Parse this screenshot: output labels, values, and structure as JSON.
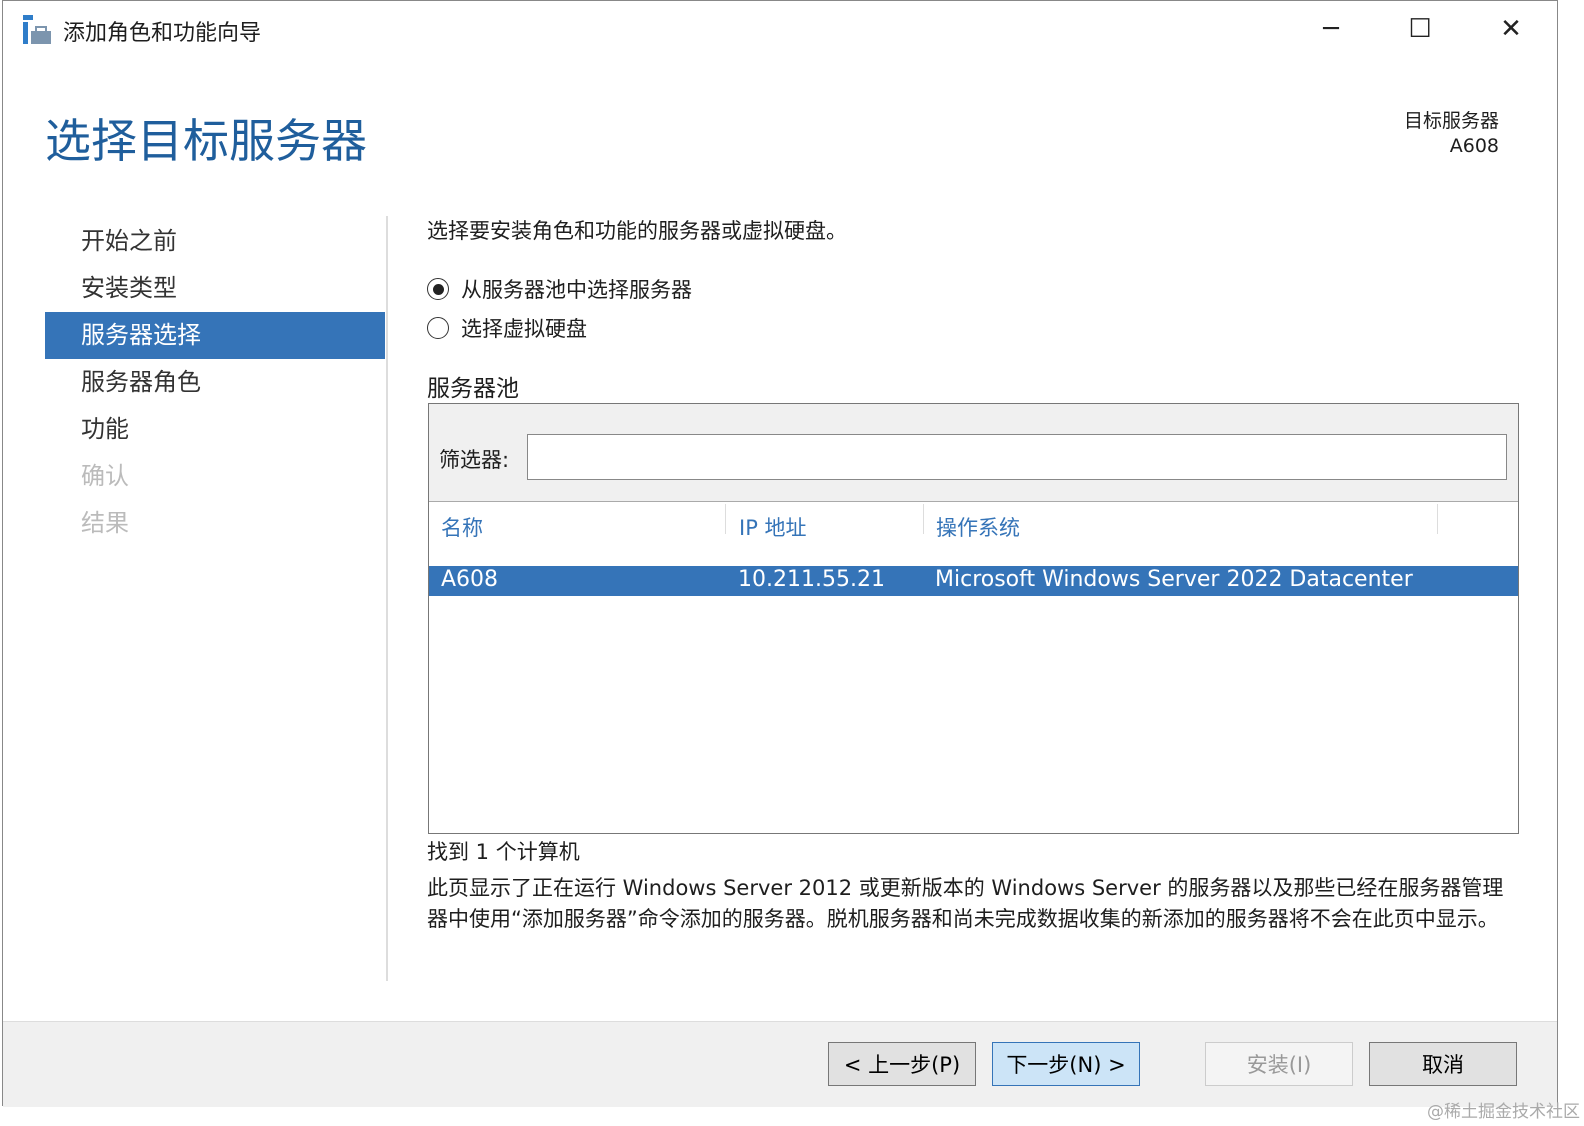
{
  "window": {
    "title": "添加角色和功能向导",
    "minimize": "─",
    "maximize": "☐",
    "close": "✕"
  },
  "header": {
    "page_title": "选择目标服务器",
    "target_label": "目标服务器",
    "target_value": "A608"
  },
  "nav": {
    "items": [
      {
        "label": "开始之前"
      },
      {
        "label": "安装类型"
      },
      {
        "label": "服务器选择"
      },
      {
        "label": "服务器角色"
      },
      {
        "label": "功能"
      },
      {
        "label": "确认"
      },
      {
        "label": "结果"
      }
    ]
  },
  "main": {
    "description": "选择要安装角色和功能的服务器或虚拟硬盘。",
    "radio_pool": "从服务器池中选择服务器",
    "radio_vhd": "选择虚拟硬盘",
    "pool_label": "服务器池",
    "filter_label": "筛选器:",
    "filter_value": "",
    "columns": [
      "名称",
      "IP 地址",
      "操作系统"
    ],
    "rows": [
      {
        "name": "A608",
        "ip": "10.211.55.21",
        "os": "Microsoft Windows Server 2022 Datacenter"
      }
    ],
    "found": "找到 1 个计算机",
    "note": "此页显示了正在运行 Windows Server 2012 或更新版本的 Windows Server 的服务器以及那些已经在服务器管理器中使用“添加服务器”命令添加的服务器。脱机服务器和尚未完成数据收集的新添加的服务器将不会在此页中显示。"
  },
  "footer": {
    "prev": "< 上一步(P)",
    "next": "下一步(N) >",
    "install": "安装(I)",
    "cancel": "取消"
  },
  "watermark": "@稀土掘金技术社区"
}
